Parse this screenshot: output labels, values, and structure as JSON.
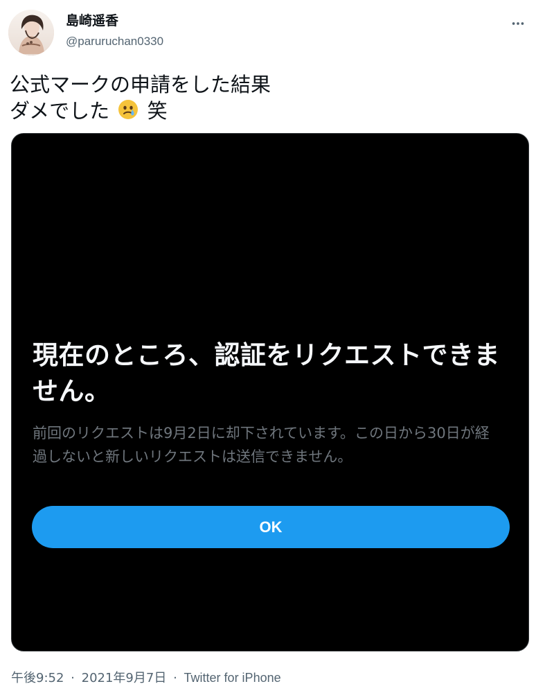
{
  "author": {
    "display_name": "島崎遥香",
    "username": "@paruruchan0330"
  },
  "tweet": {
    "line1": "公式マークの申請をした結果",
    "line2_before_emoji": "ダメでした",
    "emoji_icon": "crying-face-icon",
    "line2_after_emoji": "笑"
  },
  "media": {
    "dialog_title": "現在のところ、認証をリクエストできません。",
    "dialog_body": "前回のリクエストは9月2日に却下されています。この日から30日が経過しないと新しいリクエストは送信できません。",
    "button_label": "OK",
    "background_color": "#000000",
    "button_color": "#1d9bf0"
  },
  "meta": {
    "time": "午後9:52",
    "date": "2021年9月7日",
    "source": "Twitter for iPhone"
  },
  "colors": {
    "text": "#0f1419",
    "secondary": "#536471",
    "accent": "#1d9bf0"
  }
}
